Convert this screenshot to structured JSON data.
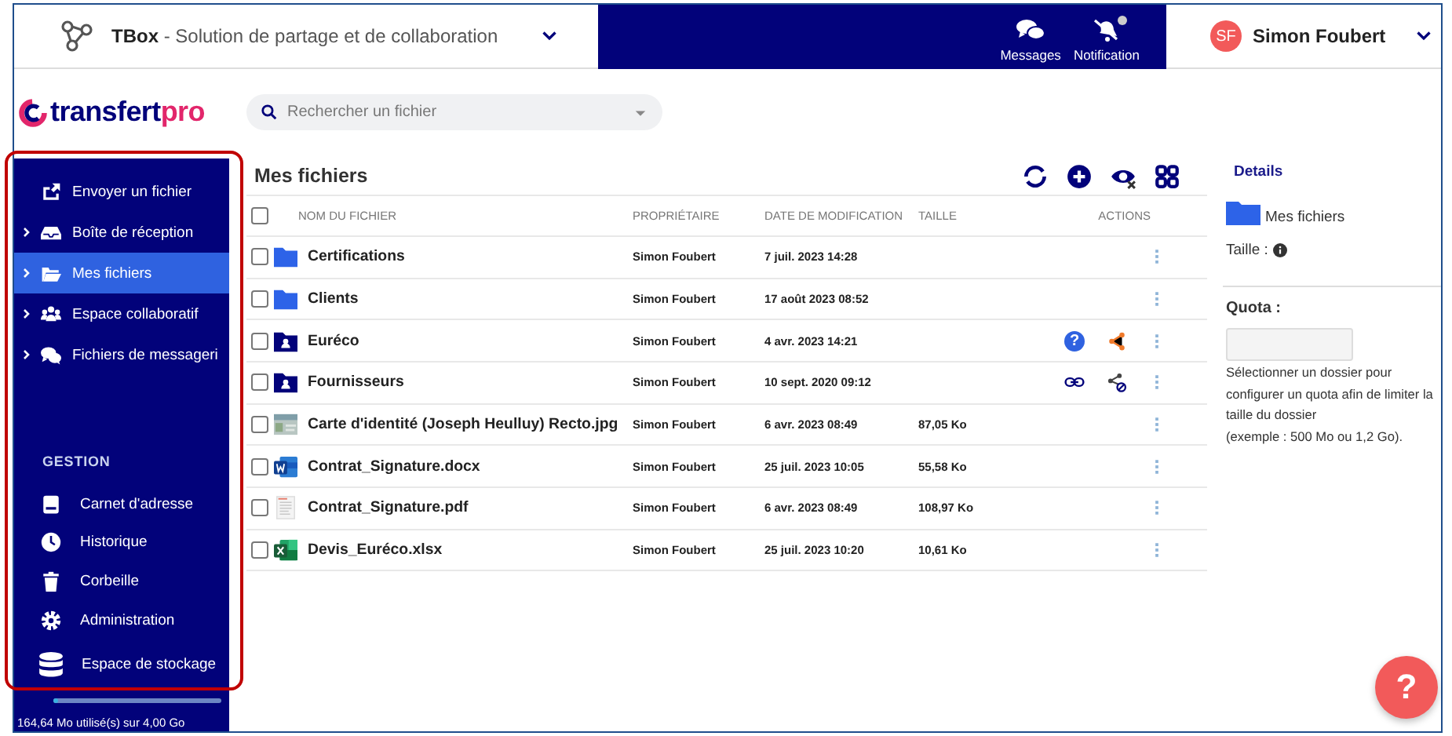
{
  "app_switcher": {
    "brand": "TBox",
    "subtitle": " - Solution de partage et de collaboration"
  },
  "header_actions": [
    {
      "kind": "messages",
      "label": "Messages",
      "unread": false
    },
    {
      "kind": "notification",
      "label": "Notification",
      "unread": true
    }
  ],
  "user": {
    "initials": "SF",
    "name": "Simon Foubert"
  },
  "logo": {
    "text": "transfert",
    "accent": "pro"
  },
  "search": {
    "placeholder": "Rechercher un fichier"
  },
  "sidebar": {
    "items": [
      {
        "kind": "upload",
        "label": "Envoyer un fichier",
        "expandable": false,
        "selected": false
      },
      {
        "kind": "inbox",
        "label": "Boîte de réception",
        "expandable": true,
        "selected": false
      },
      {
        "kind": "folder",
        "label": "Mes fichiers",
        "expandable": true,
        "selected": true
      },
      {
        "kind": "users",
        "label": "Espace collaboratif",
        "expandable": true,
        "selected": false
      },
      {
        "kind": "chat",
        "label": "Fichiers de messageri",
        "expandable": true,
        "selected": false
      }
    ],
    "section": "GESTION",
    "management_items": [
      {
        "kind": "book",
        "label": "Carnet d'adresse"
      },
      {
        "kind": "clock",
        "label": "Historique"
      },
      {
        "kind": "trash",
        "label": "Corbeille"
      },
      {
        "kind": "gear",
        "label": "Administration"
      },
      {
        "kind": "database",
        "label": "Espace de stockage"
      }
    ],
    "storage": {
      "level": 0.03,
      "usage": "164,64 Mo utilisé(s) sur 4,00 Go"
    }
  },
  "file_list": {
    "title": "Mes fichiers",
    "toolbar": [
      {
        "kind": "refresh"
      },
      {
        "kind": "add"
      },
      {
        "kind": "hidden"
      },
      {
        "kind": "grid"
      }
    ],
    "select_all_checked": false,
    "columns": [
      "NOM DU FICHIER",
      "PROPRIÉTAIRE",
      "DATE DE MODIFICATION",
      "TAILLE",
      "ACTIONS"
    ],
    "rows": [
      {
        "kind": "folder",
        "name": "Certifications",
        "owner": "Simon Foubert",
        "modified": "7 juil. 2023 14:28",
        "size": "",
        "checked": false,
        "actions": []
      },
      {
        "kind": "folder",
        "name": "Clients",
        "owner": "Simon Foubert",
        "modified": "17 août 2023 08:52",
        "size": "",
        "checked": false,
        "actions": []
      },
      {
        "kind": "shared-folder",
        "name": "Euréco",
        "owner": "Simon Foubert",
        "modified": "4 avr. 2023 14:21",
        "size": "",
        "checked": false,
        "actions": [
          {
            "kind": "help",
            "glyph": "?"
          },
          {
            "kind": "share"
          }
        ]
      },
      {
        "kind": "shared-folder",
        "name": "Fournisseurs",
        "owner": "Simon Foubert",
        "modified": "10 sept. 2020 09:12",
        "size": "",
        "checked": false,
        "actions": [
          {
            "kind": "link"
          },
          {
            "kind": "unshare"
          }
        ]
      },
      {
        "kind": "image",
        "name": "Carte d'identité (Joseph Heulluy) Recto.jpg",
        "owner": "Simon Foubert",
        "modified": "6 avr. 2023 08:49",
        "size": "87,05 Ko",
        "checked": false,
        "actions": []
      },
      {
        "kind": "word",
        "name": "Contrat_Signature.docx",
        "owner": "Simon Foubert",
        "modified": "25 juil. 2023 10:05",
        "size": "55,58 Ko",
        "checked": false,
        "actions": []
      },
      {
        "kind": "pdf",
        "name": "Contrat_Signature.pdf",
        "owner": "Simon Foubert",
        "modified": "6 avr. 2023 08:49",
        "size": "108,97 Ko",
        "checked": false,
        "actions": []
      },
      {
        "kind": "excel",
        "name": "Devis_Euréco.xlsx",
        "owner": "Simon Foubert",
        "modified": "25 juil. 2023 10:20",
        "size": "10,61 Ko",
        "checked": false,
        "actions": []
      }
    ]
  },
  "details": {
    "title": "Details",
    "folder": "Mes fichiers",
    "size_label": "Taille :",
    "quota_label": "Quota :",
    "quota_help": [
      "Sélectionner un dossier pour",
      "configurer un quota afin de limiter la",
      "taille du dossier",
      "(exemple : 500 Mo ou 1,2 Go)."
    ]
  },
  "help_button": {
    "label": "?"
  }
}
